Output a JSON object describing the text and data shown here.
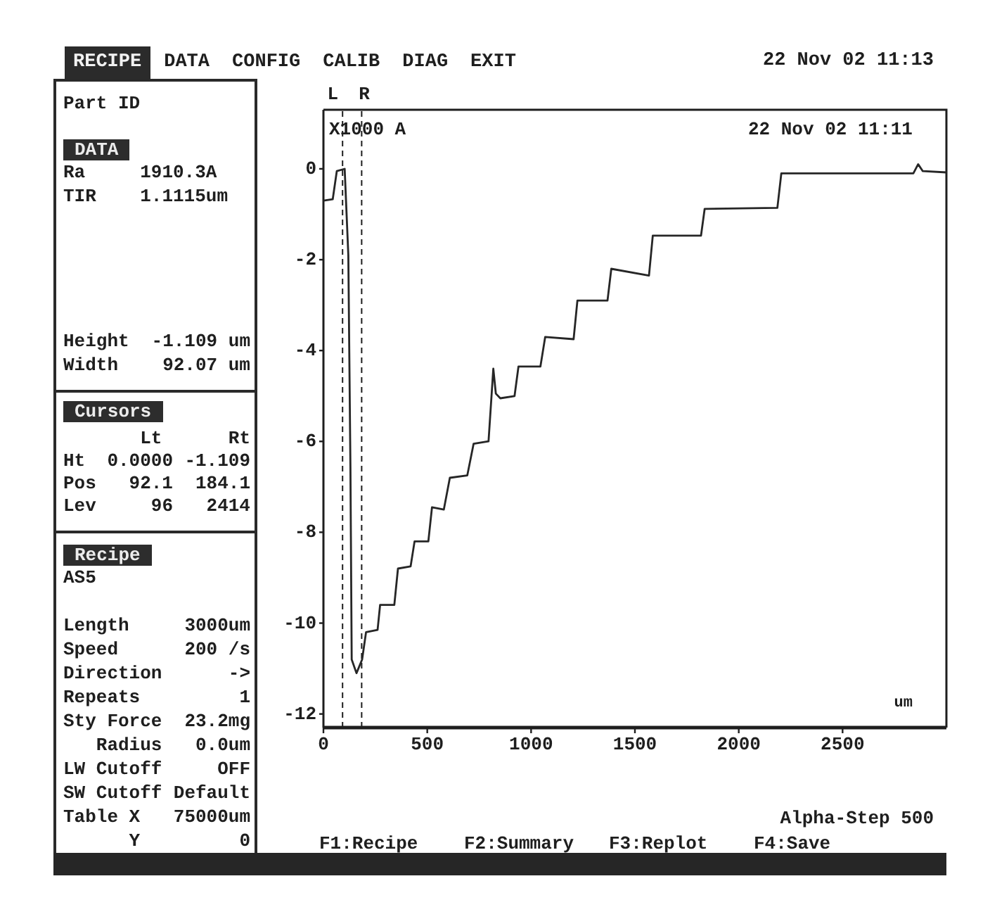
{
  "menu_bar": {
    "items": [
      {
        "label": "RECIPE",
        "selected": true
      },
      {
        "label": "DATA",
        "selected": false
      },
      {
        "label": "CONFIG",
        "selected": false
      },
      {
        "label": "CALIB",
        "selected": false
      },
      {
        "label": "DIAG",
        "selected": false
      },
      {
        "label": "EXIT",
        "selected": false
      }
    ],
    "datetime": "22 Nov 02 11:13"
  },
  "side_panel": {
    "part_id": "Part ID",
    "data": {
      "title": "DATA",
      "results": [
        {
          "label": "Ra",
          "value": "1910.3A"
        },
        {
          "label": "TIR",
          "value": "1.1115um"
        }
      ],
      "measurements": [
        {
          "label": "Height",
          "value": "-1.109 um"
        },
        {
          "label": "Width",
          "value": "92.07 um"
        }
      ]
    },
    "cursors": {
      "title": "Cursors",
      "columns": [
        "Lt",
        "Rt"
      ],
      "rows": [
        {
          "label": "Ht",
          "values": [
            "0.0000",
            "-1.109"
          ]
        },
        {
          "label": "Pos",
          "values": [
            "92.1",
            "184.1"
          ]
        },
        {
          "label": "Lev",
          "values": [
            "96",
            "2414"
          ]
        }
      ]
    },
    "recipe": {
      "title": "Recipe",
      "name": "AS5",
      "fields": [
        {
          "label": "Length",
          "value": "3000um"
        },
        {
          "label": "Speed",
          "value": "200 /s"
        },
        {
          "label": "Direction",
          "value": "->"
        },
        {
          "label": "Repeats",
          "value": "1"
        },
        {
          "label": "Sty Force",
          "value": "23.2mg",
          "children": [
            {
              "label": "Radius",
              "value": "0.0um"
            }
          ]
        },
        {
          "label": "LW Cutoff",
          "value": "OFF"
        },
        {
          "label": "SW Cutoff",
          "value": "Default"
        },
        {
          "label": "Table X",
          "value": "75000um",
          "children": [
            {
              "label": "Y",
              "value": "0"
            }
          ]
        }
      ]
    }
  },
  "chart": {
    "timestamp": "22 Nov 02 11:11",
    "chart_data": {
      "type": "line",
      "xlabel": "um",
      "ylabel": "X1000 A",
      "x": [
        0,
        45,
        64,
        102,
        120,
        130,
        136,
        159,
        186,
        205,
        261,
        273,
        341,
        359,
        420,
        439,
        505,
        523,
        580,
        609,
        693,
        723,
        795,
        818,
        830,
        852,
        920,
        939,
        1045,
        1068,
        1205,
        1223,
        1368,
        1386,
        1568,
        1586,
        1818,
        1836,
        2186,
        2205,
        2841,
        2864,
        2886,
        3000
      ],
      "values": [
        -0.7,
        -0.67,
        -0.05,
        0,
        -1.9,
        -6.6,
        -10.8,
        -11.1,
        -10.8,
        -10.2,
        -10.15,
        -9.6,
        -9.6,
        -8.8,
        -8.75,
        -8.2,
        -8.2,
        -7.45,
        -7.5,
        -6.8,
        -6.75,
        -6.05,
        -6.0,
        -4.4,
        -4.95,
        -5.05,
        -5.0,
        -4.35,
        -4.35,
        -3.7,
        -3.75,
        -2.9,
        -2.9,
        -2.2,
        -2.35,
        -1.47,
        -1.47,
        -0.88,
        -0.86,
        -0.1,
        -0.1,
        0.1,
        -0.05,
        -0.08
      ],
      "xlim": [
        0,
        3000
      ],
      "ylim": [
        -12.3,
        1.3
      ],
      "xticks": [
        0,
        500,
        1000,
        1500,
        2000,
        2500
      ],
      "yticks": [
        0,
        -2,
        -4,
        -6,
        -8,
        -10,
        -12
      ],
      "ref_lines": [
        {
          "axis": "x",
          "value": 92.1,
          "label": "L"
        },
        {
          "axis": "x",
          "value": 184.1,
          "label": "R"
        }
      ]
    }
  },
  "footer": {
    "model": "Alpha-Step 500",
    "function_keys": [
      "F1:Recipe",
      "F2:Summary",
      "F3:Replot",
      "F4:Save"
    ]
  }
}
